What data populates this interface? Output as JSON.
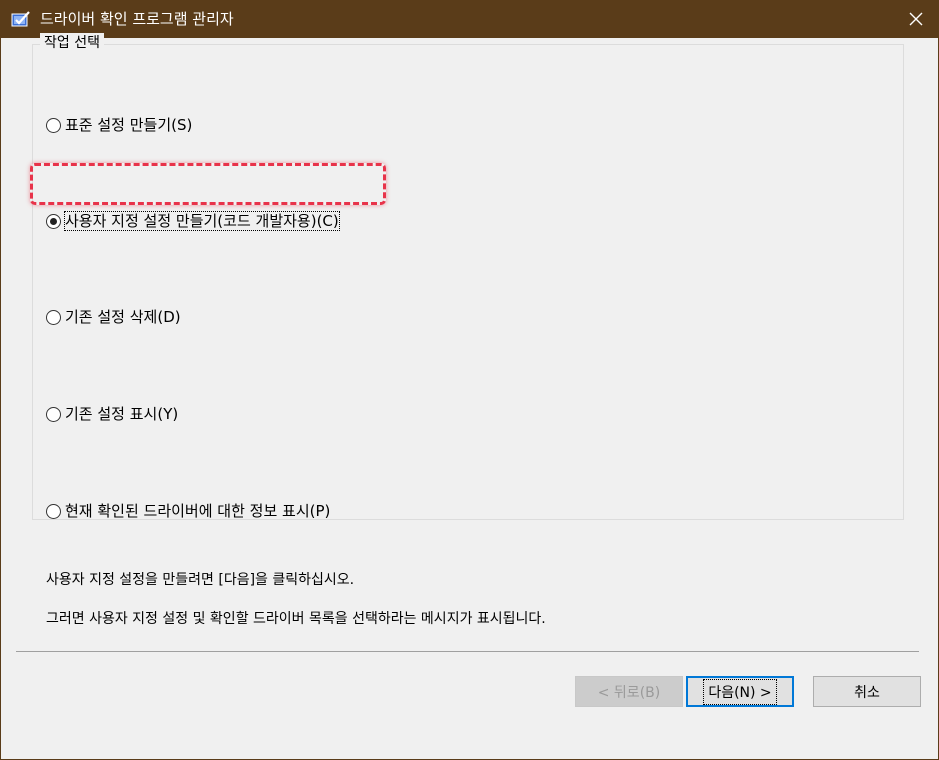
{
  "window": {
    "title": "드라이버 확인 프로그램 관리자",
    "close_glyph": "✕"
  },
  "group": {
    "legend": "작업 선택",
    "options": [
      {
        "label": "표준 설정 만들기(S)",
        "checked": false
      },
      {
        "label": "사용자 지정 설정 만들기(코드 개발자용)(C)",
        "checked": true
      },
      {
        "label": "기존 설정 삭제(D)",
        "checked": false
      },
      {
        "label": "기존 설정 표시(Y)",
        "checked": false
      },
      {
        "label": "현재 확인된 드라이버에 대한 정보 표시(P)",
        "checked": false
      }
    ]
  },
  "info": {
    "line1": "사용자 지정 설정을 만들려면 [다음]을 클릭하십시오.",
    "line2": "그러면 사용자 지정 설정 및 확인할 드라이버 목록을 선택하라는 메시지가 표시됩니다."
  },
  "buttons": {
    "back": "< 뒤로(B)",
    "next": "다음(N) >",
    "cancel": "취소"
  },
  "colors": {
    "titlebar": "#5a3c19",
    "highlight": "#e8334a",
    "accent": "#0078d7"
  }
}
